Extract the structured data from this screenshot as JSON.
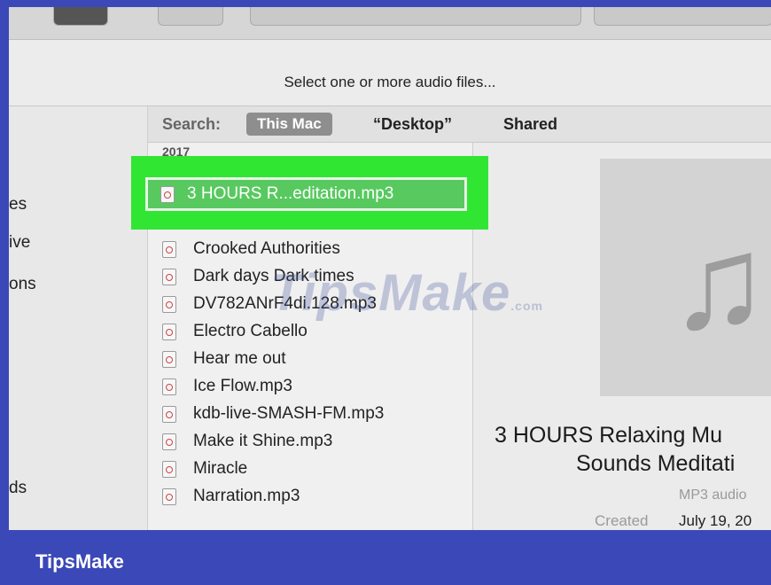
{
  "dialog": {
    "prompt": "Select one or more audio files..."
  },
  "sidebar": {
    "items": [
      "es",
      "ive",
      "ons",
      "ds"
    ]
  },
  "scope": {
    "label": "Search:",
    "options": [
      "This Mac",
      "“Desktop”",
      "Shared"
    ],
    "selected": "This Mac"
  },
  "filelist": {
    "group": "2017",
    "selected": "3 HOURS R...editation.mp3",
    "items": [
      "Crooked Authorities",
      "Dark days Dark times",
      "DV782ANrF4di.128.mp3",
      "Electro Cabello",
      "Hear me out",
      "Ice Flow.mp3",
      "kdb-live-SMASH-FM.mp3",
      "Make it Shine.mp3",
      "Miracle",
      "Narration.mp3"
    ],
    "icon": "audio-file-icon"
  },
  "preview": {
    "title_line1": "3 HOURS Relaxing Mu",
    "title_line2": "Sounds Meditati",
    "kind": "MP3 audio",
    "created_label": "Created",
    "created_value": "July 19, 20",
    "art_icon": "music-note-icon"
  },
  "watermark": {
    "text": "TipsMake",
    "suffix": ".com"
  },
  "branding": {
    "name": "TipsMake",
    "color": "#3b48b8"
  }
}
